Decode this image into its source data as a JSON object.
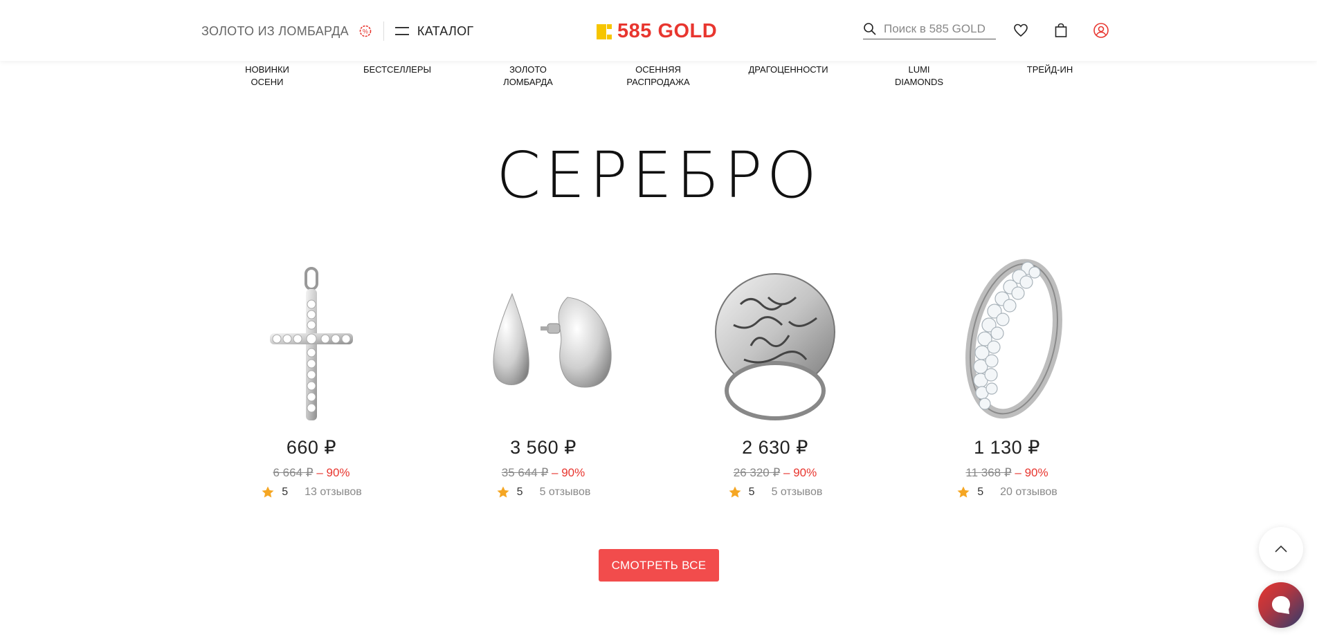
{
  "header": {
    "pawn_link": "ЗОЛОТО ИЗ ЛОМБАРДА",
    "catalog_label": "КАТАЛОГ",
    "logo_text": "585 GOLD",
    "search_placeholder": "Поиск в 585 GOLD"
  },
  "nav": {
    "items": [
      {
        "label": "НОВИНКИ\nОСЕНИ"
      },
      {
        "label": "БЕСТСЕЛЛЕРЫ"
      },
      {
        "label": "ЗОЛОТО\nЛОМБАРДА"
      },
      {
        "label": "ОСЕННЯЯ\nРАСПРОДАЖА"
      },
      {
        "label": "ДРАГОЦЕННОСТИ"
      },
      {
        "label": "LUMI\nDIAMONDS"
      },
      {
        "label": "ТРЕЙД-ИН"
      }
    ]
  },
  "section": {
    "title": "СЕРЕБРО",
    "view_all_label": "СМОТРЕТЬ ВСЕ"
  },
  "products": [
    {
      "icon": "cross-pendant",
      "price": "660 ₽",
      "old_price": "6 664 ₽",
      "discount": "– 90%",
      "rating": "5",
      "reviews": "13 отзывов"
    },
    {
      "icon": "drop-earrings",
      "price": "3 560 ₽",
      "old_price": "35 644 ₽",
      "discount": "– 90%",
      "rating": "5",
      "reviews": "5 отзывов"
    },
    {
      "icon": "ornate-ring",
      "price": "2 630 ₽",
      "old_price": "26 320 ₽",
      "discount": "– 90%",
      "rating": "5",
      "reviews": "5 отзывов"
    },
    {
      "icon": "eternity-ring",
      "price": "1 130 ₽",
      "old_price": "11 368 ₽",
      "discount": "– 90%",
      "rating": "5",
      "reviews": "20 отзывов"
    }
  ],
  "colors": {
    "brand_red": "#e8362f",
    "star": "#f5a623",
    "button": "#f24c4c"
  }
}
